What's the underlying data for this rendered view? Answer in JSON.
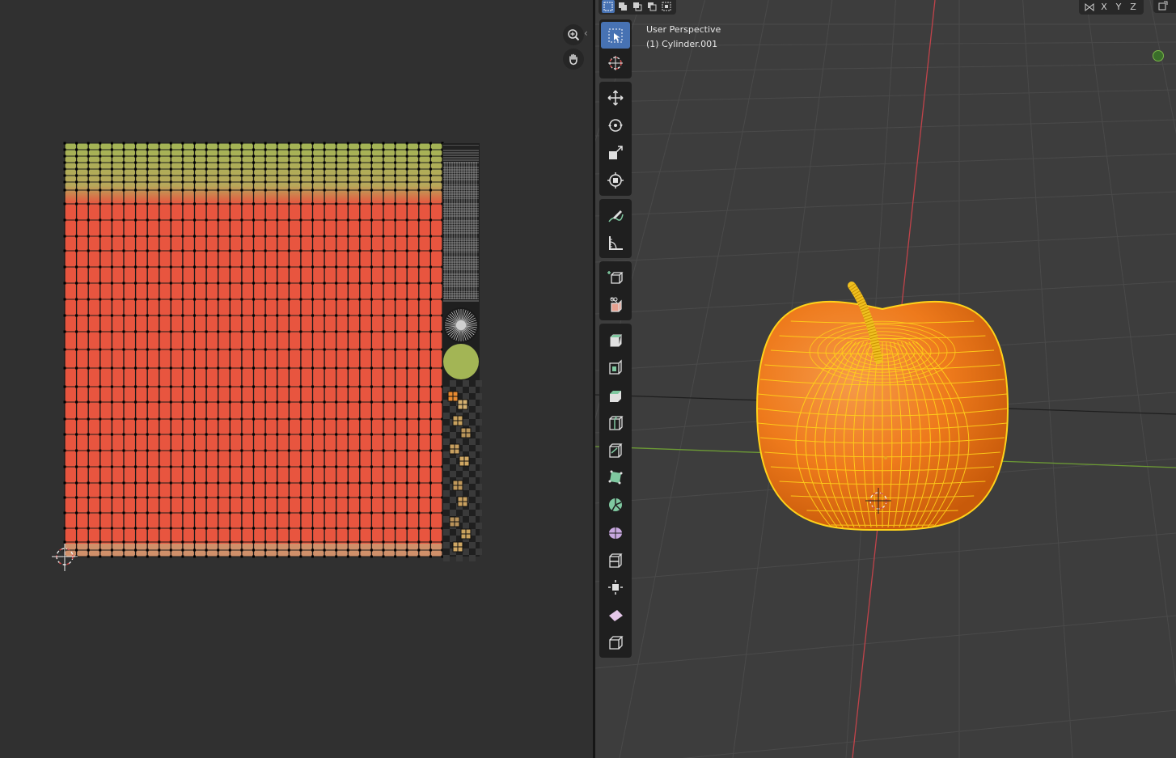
{
  "uv_editor": {
    "nav": {
      "zoom_icon": "zoom-icon",
      "hand_icon": "hand-pan-icon",
      "collapse_icon": "chevron-left-icon",
      "collapse_glyph": "‹"
    },
    "colors": {
      "background": "#303030",
      "apple_skin": "#e8553f",
      "leaf_green": "#a3b555",
      "dark_strip": "#1f1f1f"
    }
  },
  "viewport": {
    "view_name": "User Perspective",
    "object_name": "(1) Cylinder.001",
    "axis_lock": [
      "X",
      "Y",
      "Z"
    ],
    "selection_modes": [
      "set-selection-icon",
      "extend-selection-icon",
      "subtract-selection-icon",
      "difference-selection-icon",
      "intersect-selection-icon"
    ],
    "toolbar": {
      "groups": [
        [
          "select-box-icon",
          "cursor-icon"
        ],
        [
          "move-icon",
          "rotate-icon",
          "scale-icon",
          "transform-icon"
        ],
        [
          "annotate-icon",
          "measure-icon"
        ],
        [
          "add-cube-icon",
          "add-object-icon"
        ],
        [
          "extrude-icon",
          "inset-icon",
          "bevel-icon",
          "loop-cut-icon",
          "knife-icon",
          "poly-build-icon",
          "spin-icon",
          "smooth-icon",
          "edge-slide-icon",
          "shrink-fatten-icon",
          "shear-icon",
          "rip-region-icon"
        ]
      ]
    },
    "colors": {
      "background": "#3d3d3d",
      "x_axis": "#c0434a",
      "y_axis": "#6c9a35",
      "apple_orange": "#f07818",
      "wire_yellow": "#ffd21a",
      "active_tool": "#4772b3"
    }
  }
}
